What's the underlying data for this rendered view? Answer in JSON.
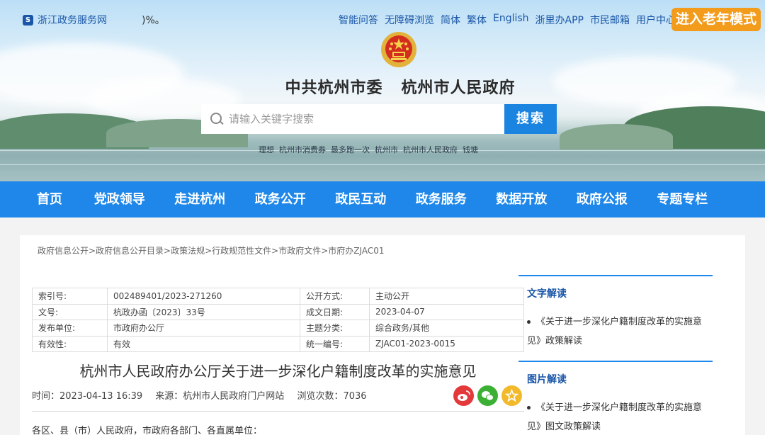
{
  "top": {
    "site_name": "浙江政务服务网",
    "partial_text": ")%。",
    "links": [
      "智能问答",
      "无障碍浏览",
      "简体",
      "繁体",
      "English",
      "浙里办APP",
      "市民邮箱",
      "用户中心"
    ],
    "elder_mode": "进入老年模式"
  },
  "header": {
    "title": "中共杭州市委   杭州市人民政府"
  },
  "search": {
    "placeholder": "请输入关键字搜索",
    "button": "搜索"
  },
  "hotwords": [
    "理想",
    "杭州市消费券",
    "最多跑一次",
    "杭州市",
    "杭州市人民政府",
    "钱塘"
  ],
  "nav": [
    "首页",
    "党政领导",
    "走进杭州",
    "政务公开",
    "政民互动",
    "政务服务",
    "数据开放",
    "政府公报",
    "专题专栏"
  ],
  "breadcrumb": "政府信息公开>政府信息公开目录>政策法规>行政规范性文件>市政府文件>市府办ZJAC01",
  "info": {
    "rows": [
      [
        "索引号:",
        "002489401/2023-271260",
        "公开方式:",
        "主动公开"
      ],
      [
        "文号:",
        "杭政办函〔2023〕33号",
        "成文日期:",
        "2023-04-07"
      ],
      [
        "发布单位:",
        "市政府办公厅",
        "主题分类:",
        "综合政务/其他"
      ],
      [
        "有效性:",
        "有效",
        "统一编号:",
        "ZJAC01-2023-0015"
      ]
    ]
  },
  "doc": {
    "title": "杭州市人民政府办公厅关于进一步深化户籍制度改革的实施意见",
    "time": "时间：2023-04-13 16:39",
    "source": "来源：杭州市人民政府门户网站",
    "views": "浏览次数：7036",
    "body_start": "各区、县（市）人民政府，市政府各部门、各直属单位："
  },
  "side": {
    "text_head": "文字解读",
    "text_item": "《关于进一步深化户籍制度改革的实施意见》政策解读",
    "img_head": "图片解读",
    "img_item": "《关于进一步深化户籍制度改革的实施意见》图文政策解读"
  },
  "colors": {
    "nav_blue": "#1e87e9",
    "elder_orange": "#f39b1a",
    "search_blue": "#1b84e0"
  }
}
